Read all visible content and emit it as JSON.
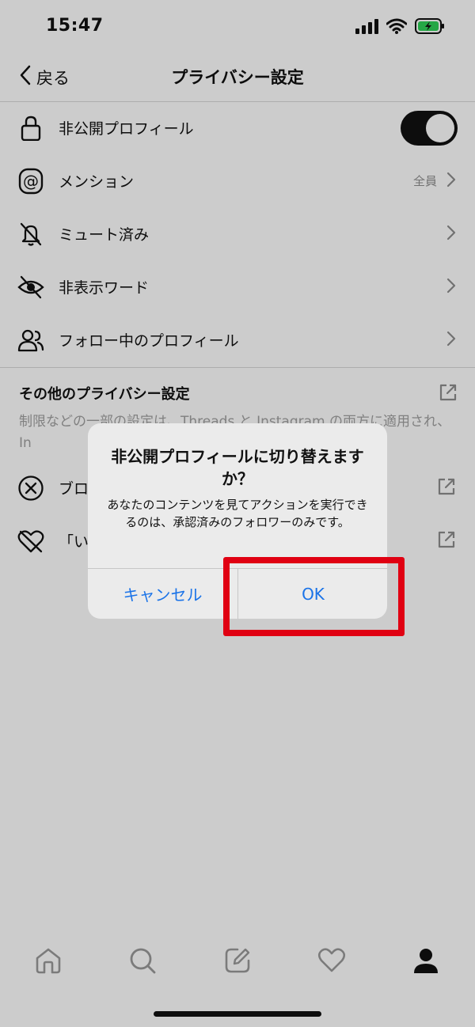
{
  "status_bar": {
    "time": "15:47"
  },
  "nav": {
    "back_label": "戻る",
    "title": "プライバシー設定"
  },
  "items": [
    {
      "label": "非公開プロフィール",
      "icon": "lock-icon",
      "control": "toggle",
      "toggle_on": true
    },
    {
      "label": "メンション",
      "icon": "at-icon",
      "value": "全員",
      "control": "chevron"
    },
    {
      "label": "ミュート済み",
      "icon": "muted-bell-icon",
      "control": "chevron"
    },
    {
      "label": "非表示ワード",
      "icon": "hidden-eye-icon",
      "control": "chevron"
    },
    {
      "label": "フォロー中のプロフィール",
      "icon": "people-icon",
      "control": "chevron"
    }
  ],
  "other_section": {
    "title": "その他のプライバシー設定",
    "description": "制限などの一部の設定は、Threads と Instagram の両方に適用され、In",
    "items": [
      {
        "label": "ブロ",
        "icon": "block-icon"
      },
      {
        "label": "「い",
        "icon": "broken-heart-icon"
      }
    ]
  },
  "dialog": {
    "title": "非公開プロフィールに切り替えますか？",
    "message": "あなたのコンテンツを見てアクションを実行できるのは、承認済みのフォロワーのみです。",
    "cancel_label": "キャンセル",
    "ok_label": "OK"
  },
  "colors": {
    "accent": "#1a73e8",
    "highlight": "#e00012"
  },
  "tab_bar": [
    "home-icon",
    "search-icon",
    "compose-icon",
    "heart-icon",
    "profile-icon"
  ]
}
